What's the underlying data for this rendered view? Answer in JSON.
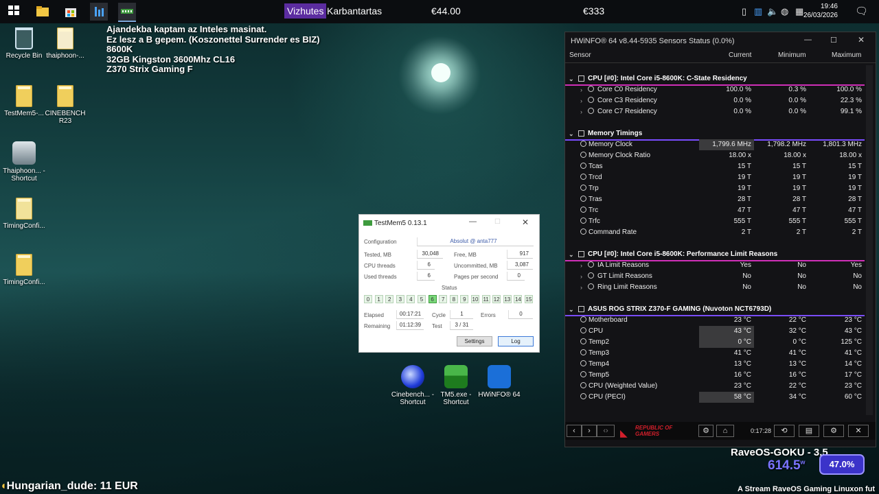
{
  "taskbar": {
    "ticker": {
      "label1": "Vizhutes",
      "label2": "Karbantartas",
      "amount1": "€44.00",
      "amount2": "€333"
    },
    "clock": {
      "time": "19:46",
      "date": "26/03/2026"
    }
  },
  "desktop": {
    "icons": [
      {
        "label": "Recycle Bin"
      },
      {
        "label": "thaiphoon-..."
      },
      {
        "label": "TestMem5-..."
      },
      {
        "label": "CINEBENCH R23"
      },
      {
        "label": "Thaiphoon... - Shortcut"
      },
      {
        "label": "TimingConfi..."
      },
      {
        "label": "TimingConfi..."
      },
      {
        "label": "Cinebench... - Shortcut"
      },
      {
        "label": "TM5.exe - Shortcut"
      },
      {
        "label": "HWiNFO® 64"
      }
    ],
    "overlay_lines": [
      "Ajandekba kaptam az Inteles masinat.",
      "Ez lesz a B gepem. (Koszonettel Surrender es BIZ)",
      "8600K",
      "32GB Kingston 3600Mhz CL16",
      "Z370 Strix Gaming F"
    ],
    "donor": "Hungarian_dude: 11 EUR",
    "stream": {
      "name": "RaveOS-GOKU - 3.5",
      "power": "614.5",
      "power_unit": "w",
      "percent": "47.0%",
      "footer": "A Stream RaveOS Gaming Linuxon fut"
    }
  },
  "testmem": {
    "title": "TestMem5  0.13.1",
    "configuration_label": "Configuration",
    "configuration_value": "Absolut @ anta777",
    "tested_label": "Tested, MB",
    "tested_value": "30,048",
    "free_label": "Free, MB",
    "free_value": "917",
    "cpu_threads_label": "CPU threads",
    "cpu_threads_value": "6",
    "uncommitted_label": "Uncommitted, MB",
    "uncommitted_value": "3,087",
    "used_threads_label": "Used threads",
    "used_threads_value": "6",
    "pages_label": "Pages per second",
    "pages_value": "0",
    "status_label": "Status",
    "status_cells": [
      "0",
      "1",
      "2",
      "3",
      "4",
      "5",
      "6",
      "7",
      "8",
      "9",
      "10",
      "11",
      "12",
      "13",
      "14",
      "15"
    ],
    "active_cell": "6",
    "elapsed_label": "Elapsed",
    "elapsed_value": "00:17:21",
    "cycle_label": "Cycle",
    "cycle_value": "1",
    "errors_label": "Errors",
    "errors_value": "0",
    "remaining_label": "Remaining",
    "remaining_value": "01:12:39",
    "test_label": "Test",
    "test_value": "3 / 31",
    "settings_button": "Settings",
    "log_button": "Log"
  },
  "hwinfo": {
    "title": "HWiNFO® 64 v8.44-5935 Sensors Status (0.0%)",
    "columns": [
      "Sensor",
      "Current",
      "Minimum",
      "Maximum"
    ],
    "sections": [
      {
        "title": "CPU [#0]: Intel Core i5-8600K: C-State Residency",
        "rows": [
          {
            "name": "Core C0 Residency",
            "current": "100.0 %",
            "min": "0.3 %",
            "max": "100.0 %",
            "expand": true
          },
          {
            "name": "Core C3 Residency",
            "current": "0.0 %",
            "min": "0.0 %",
            "max": "22.3 %",
            "expand": true
          },
          {
            "name": "Core C7 Residency",
            "current": "0.0 %",
            "min": "0.0 %",
            "max": "99.1 %",
            "expand": true
          }
        ]
      },
      {
        "title": "Memory Timings",
        "rows": [
          {
            "name": "Memory Clock",
            "current": "1,799.6 MHz",
            "min": "1,798.2 MHz",
            "max": "1,801.3 MHz",
            "hl": true
          },
          {
            "name": "Memory Clock Ratio",
            "current": "18.00 x",
            "min": "18.00 x",
            "max": "18.00 x"
          },
          {
            "name": "Tcas",
            "current": "15 T",
            "min": "15 T",
            "max": "15 T"
          },
          {
            "name": "Trcd",
            "current": "19 T",
            "min": "19 T",
            "max": "19 T"
          },
          {
            "name": "Trp",
            "current": "19 T",
            "min": "19 T",
            "max": "19 T"
          },
          {
            "name": "Tras",
            "current": "28 T",
            "min": "28 T",
            "max": "28 T"
          },
          {
            "name": "Trc",
            "current": "47 T",
            "min": "47 T",
            "max": "47 T"
          },
          {
            "name": "Trfc",
            "current": "555 T",
            "min": "555 T",
            "max": "555 T"
          },
          {
            "name": "Command Rate",
            "current": "2 T",
            "min": "2 T",
            "max": "2 T"
          }
        ]
      },
      {
        "title": "CPU [#0]: Intel Core i5-8600K: Performance Limit Reasons",
        "rows": [
          {
            "name": "IA Limit Reasons",
            "current": "Yes",
            "min": "No",
            "max": "Yes",
            "expand": true
          },
          {
            "name": "GT Limit Reasons",
            "current": "No",
            "min": "No",
            "max": "No",
            "expand": true
          },
          {
            "name": "Ring Limit Reasons",
            "current": "No",
            "min": "No",
            "max": "No",
            "expand": true
          }
        ]
      },
      {
        "title": "ASUS ROG STRIX Z370-F GAMING (Nuvoton NCT6793D)",
        "rows": [
          {
            "name": "Motherboard",
            "current": "23 °C",
            "min": "22 °C",
            "max": "23 °C"
          },
          {
            "name": "CPU",
            "current": "43 °C",
            "min": "32 °C",
            "max": "43 °C",
            "hl": true
          },
          {
            "name": "Temp2",
            "current": "0 °C",
            "min": "0 °C",
            "max": "125 °C",
            "hl": true
          },
          {
            "name": "Temp3",
            "current": "41 °C",
            "min": "41 °C",
            "max": "41 °C"
          },
          {
            "name": "Temp4",
            "current": "13 °C",
            "min": "13 °C",
            "max": "14 °C"
          },
          {
            "name": "Temp5",
            "current": "16 °C",
            "min": "16 °C",
            "max": "17 °C"
          },
          {
            "name": "CPU (Weighted Value)",
            "current": "23 °C",
            "min": "22 °C",
            "max": "23 °C"
          },
          {
            "name": "CPU (PECI)",
            "current": "58 °C",
            "min": "34 °C",
            "max": "60 °C",
            "hl": true
          }
        ]
      }
    ],
    "bottom": {
      "brand_line1": "REPUBLIC OF",
      "brand_line2": "GAMERS",
      "elapsed": "0:17:28"
    }
  }
}
